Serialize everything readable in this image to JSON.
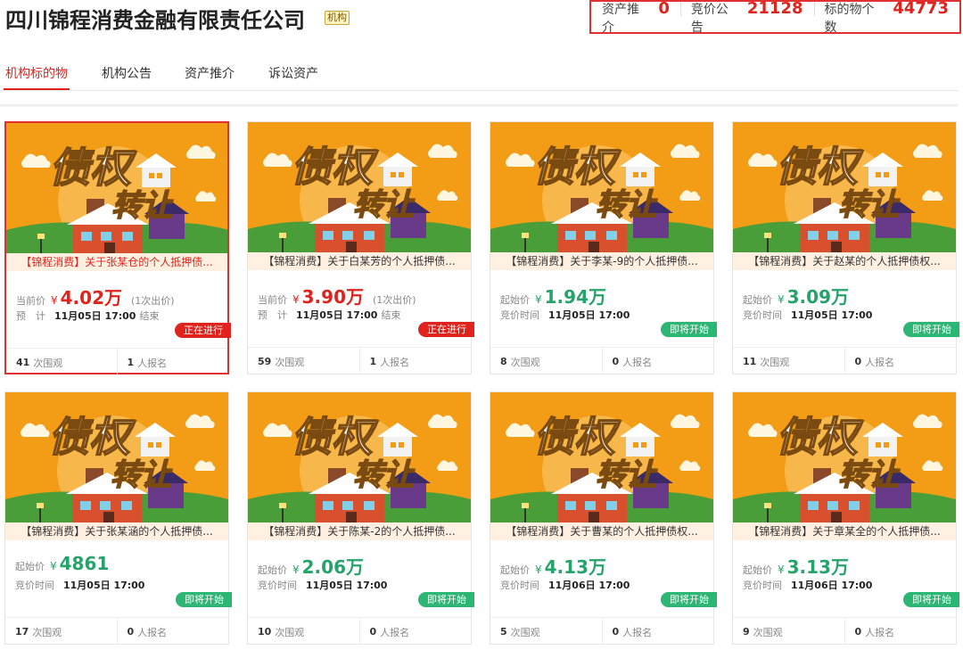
{
  "header": {
    "title": "四川锦程消费金融有限责任公司",
    "badge": "机构",
    "stats": [
      {
        "label": "资产推介",
        "value": "0"
      },
      {
        "label": "竞价公告",
        "value": "21128"
      },
      {
        "label": "标的物个数",
        "value": "44773"
      }
    ]
  },
  "tabs": [
    "机构标的物",
    "机构公告",
    "资产推介",
    "诉讼资产"
  ],
  "banner": {
    "line1": "债权",
    "line2": "转让"
  },
  "colors": {
    "accent": "#e0231c",
    "green": "#25a36a",
    "orange": "#f39c16"
  },
  "views_suffix": "次围观",
  "signups_suffix": "人报名",
  "cards": [
    {
      "title": "【锦程消费】关于张某仓的个人抵押债...",
      "price_label": "当前价",
      "yen": "¥",
      "price": "4.02万",
      "bids": "(1次出价)",
      "time_label": "预　计",
      "time": "11月05日 17:00",
      "time_suffix": "结束",
      "status": "正在进行",
      "views": "41",
      "signups": "1"
    },
    {
      "title": "【锦程消费】关于白某芳的个人抵押债...",
      "price_label": "当前价",
      "yen": "¥",
      "price": "3.90万",
      "bids": "(1次出价)",
      "time_label": "预　计",
      "time": "11月05日 17:00",
      "time_suffix": "结束",
      "status": "正在进行",
      "views": "59",
      "signups": "1"
    },
    {
      "title": "【锦程消费】关于李某-9的个人抵押债...",
      "price_label": "起始价",
      "yen": "¥",
      "price": "1.94万",
      "bids": "",
      "time_label": "竞价时间",
      "time": "11月05日 17:00",
      "time_suffix": "",
      "status": "即将开始",
      "views": "8",
      "signups": "0"
    },
    {
      "title": "【锦程消费】关于赵某的个人抵押债权...",
      "price_label": "起始价",
      "yen": "¥",
      "price": "3.09万",
      "bids": "",
      "time_label": "竞价时间",
      "time": "11月05日 17:00",
      "time_suffix": "",
      "status": "即将开始",
      "views": "11",
      "signups": "0"
    },
    {
      "title": "【锦程消费】关于张某涵的个人抵押债...",
      "price_label": "起始价",
      "yen": "¥",
      "price": "4861",
      "bids": "",
      "time_label": "竞价时间",
      "time": "11月05日 17:00",
      "time_suffix": "",
      "status": "即将开始",
      "views": "17",
      "signups": "0"
    },
    {
      "title": "【锦程消费】关于陈某-2的个人抵押债...",
      "price_label": "起始价",
      "yen": "¥",
      "price": "2.06万",
      "bids": "",
      "time_label": "竞价时间",
      "time": "11月05日 17:00",
      "time_suffix": "",
      "status": "即将开始",
      "views": "10",
      "signups": "0"
    },
    {
      "title": "【锦程消费】关于曹某的个人抵押债权...",
      "price_label": "起始价",
      "yen": "¥",
      "price": "4.13万",
      "bids": "",
      "time_label": "竞价时间",
      "time": "11月06日 17:00",
      "time_suffix": "",
      "status": "即将开始",
      "views": "5",
      "signups": "0"
    },
    {
      "title": "【锦程消费】关于章某全的个人抵押债...",
      "price_label": "起始价",
      "yen": "¥",
      "price": "3.13万",
      "bids": "",
      "time_label": "竞价时间",
      "time": "11月06日 17:00",
      "time_suffix": "",
      "status": "即将开始",
      "views": "9",
      "signups": "0"
    }
  ]
}
